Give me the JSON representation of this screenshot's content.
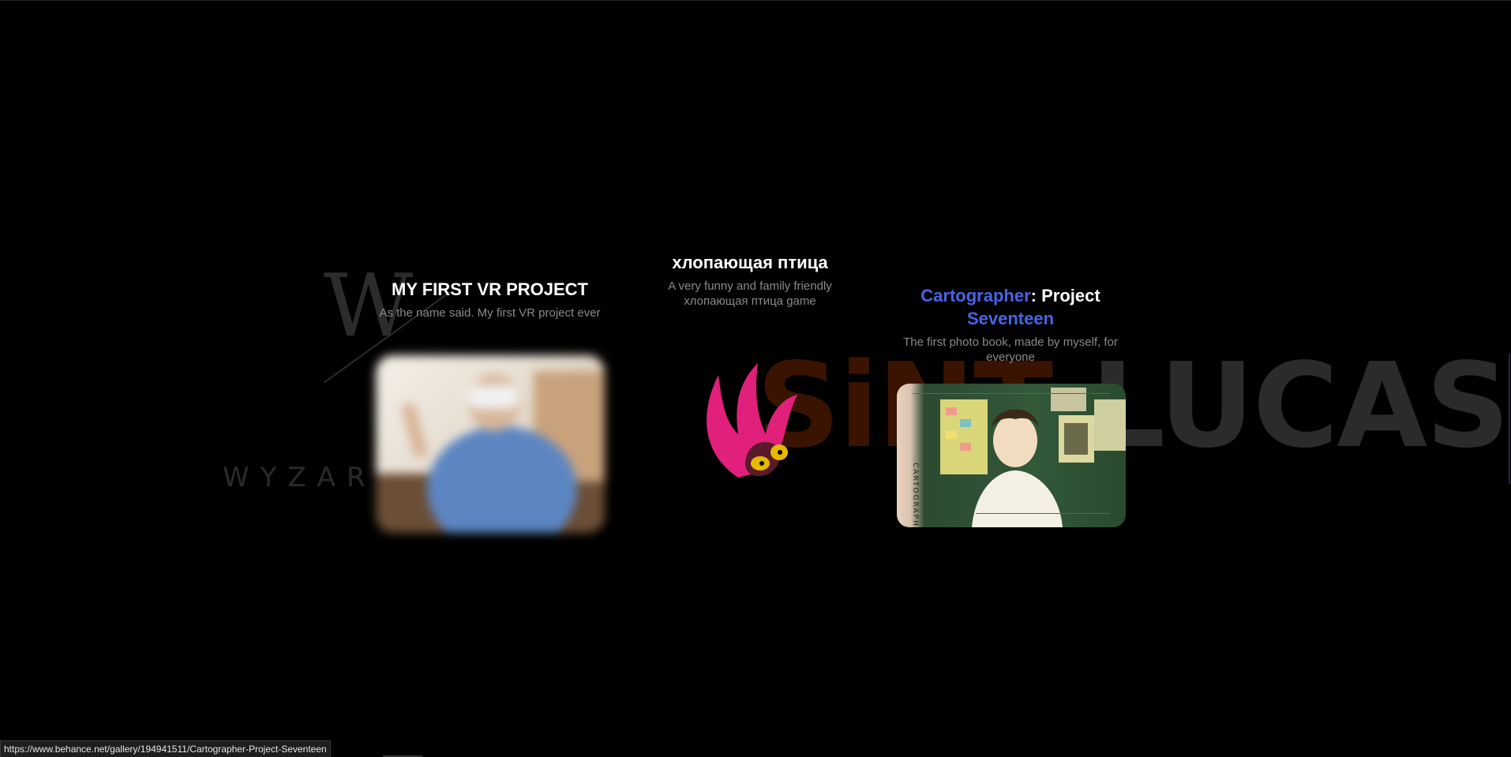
{
  "background": {
    "wyzar_word": "WYZAR",
    "sintlucas_sint": "SiNT",
    "sintlucas_lucas": "LUCAS"
  },
  "projects": [
    {
      "title": "MY FIRST VR PROJECT",
      "subtitle": "As the name said. My first VR project ever"
    },
    {
      "title": "хлопающая птица",
      "subtitle": "A very funny and family friendly хлопающая птица game"
    },
    {
      "title_accent": "Cartographer",
      "title_rest": ": Project",
      "title_accent2": "Seventeen",
      "subtitle": "The first photo book, made by myself, for everyone",
      "cover_vertical_text": "CARTOGRAPHER"
    }
  ],
  "status_bar": {
    "url": "https://www.behance.net/gallery/194941511/Cartographer-Project-Seventeen"
  },
  "colors": {
    "background": "#000000",
    "accent_blue": "#4a64e6",
    "subtitle_gray": "#8a8a8a",
    "bird_pink": "#e0207a",
    "bird_yellow": "#e6b800"
  },
  "icons": {
    "wyzar_logo": "wyzar-monogram-icon",
    "bird_logo": "flapping-bird-icon"
  }
}
